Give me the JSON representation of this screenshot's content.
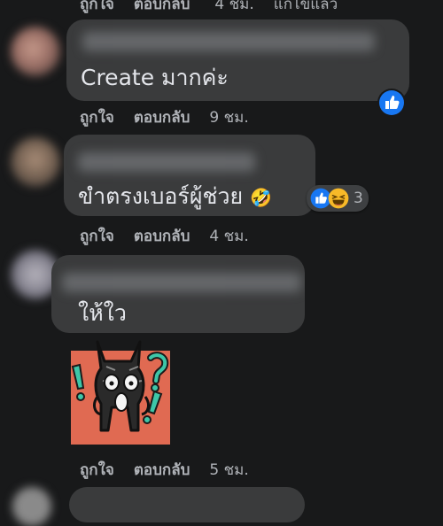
{
  "comments": [
    {
      "id": "c0",
      "actions": {
        "like": "ถูกใจ",
        "reply": "ตอบกลับ",
        "time": "4 ชม.",
        "edited": "แก้ไขแล้ว"
      }
    },
    {
      "id": "c1",
      "text": "Create มากค่ะ",
      "reactions": {
        "icons": [
          "like-icon"
        ],
        "count": ""
      },
      "actions": {
        "like": "ถูกใจ",
        "reply": "ตอบกลับ",
        "time": "9 ชม."
      }
    },
    {
      "id": "c2",
      "text": "ขำตรงเบอร์ผู้ช่วย",
      "emoji": "🤣",
      "reactions": {
        "icons": [
          "like-icon",
          "haha-icon"
        ],
        "count": "3"
      },
      "actions": {
        "like": "ถูกใจ",
        "reply": "ตอบกลับ",
        "time": "4 ชม."
      }
    },
    {
      "id": "c3",
      "text": "ให้ใว",
      "sticker": "cat-sticker-shocked",
      "actions": {
        "like": "ถูกใจ",
        "reply": "ตอบกลับ",
        "time": "5 ชม."
      }
    }
  ],
  "colors": {
    "background": "#18191a",
    "bubble": "#3a3b3c",
    "text": "#e4e6eb",
    "secondary_text": "#b0b3b8",
    "like_blue": "#1877f2",
    "haha_yellow": "#f7b928"
  }
}
